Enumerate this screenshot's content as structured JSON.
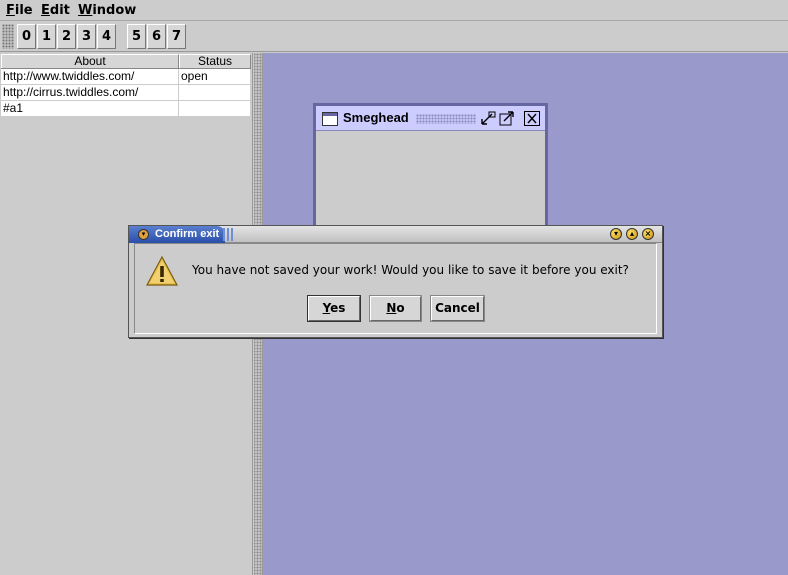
{
  "menubar": {
    "items": [
      {
        "mnemonic": "F",
        "rest": "ile"
      },
      {
        "mnemonic": "E",
        "rest": "dit"
      },
      {
        "mnemonic": "W",
        "rest": "indow"
      }
    ]
  },
  "toolbar": {
    "buttons": [
      "0",
      "1",
      "2",
      "3",
      "4",
      "5",
      "6",
      "7"
    ]
  },
  "table": {
    "headers": [
      "About",
      "Status"
    ],
    "rows": [
      [
        "http://www.twiddles.com/",
        "open"
      ],
      [
        "http://cirrus.twiddles.com/",
        ""
      ],
      [
        "#a1",
        ""
      ]
    ]
  },
  "internal_frame": {
    "title": "Smeghead",
    "icons": [
      "window-icon",
      "iconify-icon",
      "maximize-icon",
      "close-icon"
    ]
  },
  "dialog": {
    "title": "Confirm exit",
    "message": "You have not saved your work! Would you like to save it before you exit?",
    "icon": "warning-icon",
    "buttons": {
      "yes": {
        "mnemonic": "Y",
        "rest": "es"
      },
      "no": {
        "mnemonic": "N",
        "rest": "o"
      },
      "cancel": "Cancel"
    }
  },
  "colors": {
    "desktop": "#9999cc",
    "panel": "#cccccc",
    "dialog_title_accent": "#2a4ea8"
  }
}
